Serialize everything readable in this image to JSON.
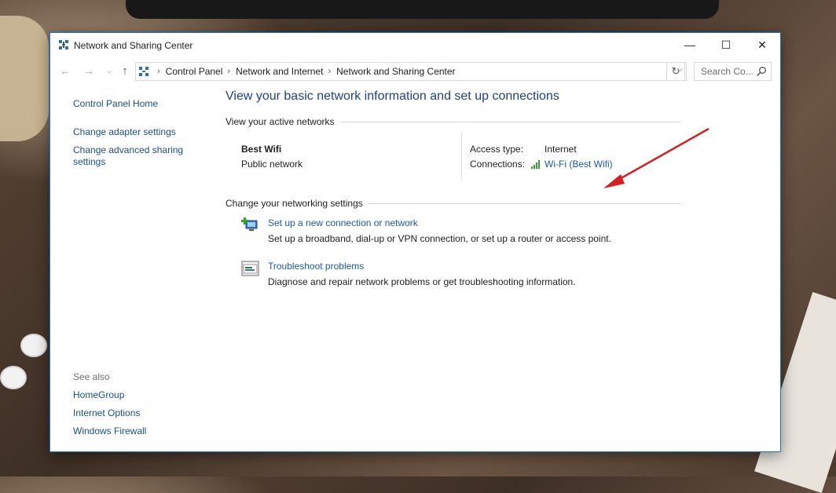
{
  "window": {
    "title": "Network and Sharing Center",
    "controls": {
      "minimize": "—",
      "maximize": "☐",
      "close": "✕"
    }
  },
  "nav": {
    "back": "←",
    "forward": "→",
    "recent": "⌄",
    "up": "↑",
    "breadcrumb": [
      "Control Panel",
      "Network and Internet",
      "Network and Sharing Center"
    ],
    "refresh": "↻",
    "search_placeholder": "Search Co..."
  },
  "sidebar": {
    "items": [
      "Control Panel Home",
      "Change adapter settings",
      "Change advanced sharing settings"
    ],
    "see_also_heading": "See also",
    "see_also": [
      "HomeGroup",
      "Internet Options",
      "Windows Firewall"
    ]
  },
  "main": {
    "heading": "View your basic network information and set up connections",
    "active_networks_heading": "View your active networks",
    "network": {
      "name": "Best Wifi",
      "type": "Public network",
      "access_type_label": "Access type:",
      "access_type_value": "Internet",
      "connections_label": "Connections:",
      "connections_value": "Wi-Fi (Best Wifi)"
    },
    "settings_heading": "Change your networking settings",
    "tasks": [
      {
        "icon": "network-setup-icon",
        "link": "Set up a new connection or network",
        "desc": "Set up a broadband, dial-up or VPN connection, or set up a router or access point."
      },
      {
        "icon": "troubleshoot-icon",
        "link": "Troubleshoot problems",
        "desc": "Diagnose and repair network problems or get troubleshooting information."
      }
    ]
  },
  "colors": {
    "heading": "#1d3f8c",
    "link": "#1a5aa8",
    "window_border": "#1a74c4",
    "arrow": "#d42020"
  }
}
